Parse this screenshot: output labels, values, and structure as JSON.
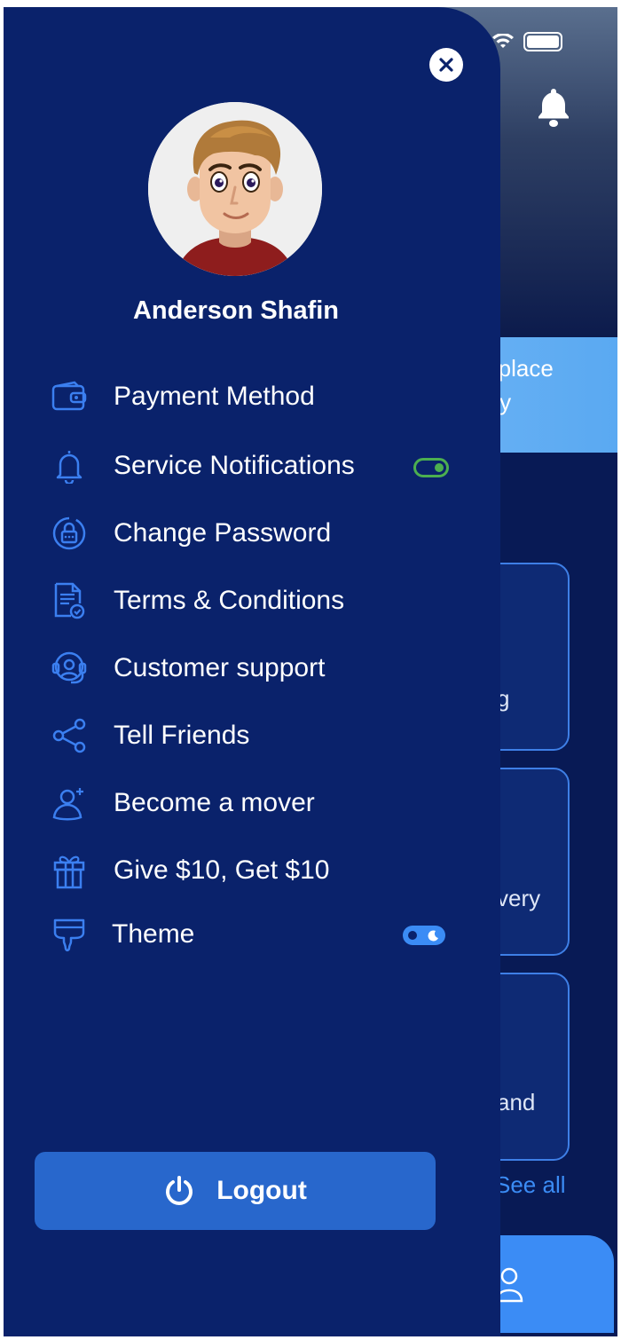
{
  "background_app": {
    "banner_line1": "etplace",
    "banner_line2": "ery",
    "card1_text": "g",
    "card2_text": "very",
    "card3_text": "and",
    "see_all": "See all"
  },
  "drawer": {
    "user_name": "Anderson Shafin",
    "menu": [
      {
        "label": "Payment Method",
        "icon": "wallet-icon"
      },
      {
        "label": "Service Notifications",
        "icon": "bell-icon"
      },
      {
        "label": "Change Password",
        "icon": "lock-icon"
      },
      {
        "label": "Terms & Conditions",
        "icon": "document-check-icon"
      },
      {
        "label": "Customer support",
        "icon": "headset-icon"
      },
      {
        "label": "Tell Friends",
        "icon": "share-icon"
      },
      {
        "label": "Become a mover",
        "icon": "user-plus-icon"
      },
      {
        "label": "Give $10, Get $10",
        "icon": "gift-icon"
      },
      {
        "label": "Theme",
        "icon": "paint-brush-icon"
      }
    ],
    "notifications_enabled": true,
    "dark_theme_enabled": true,
    "logout_label": "Logout"
  },
  "colors": {
    "drawer_bg": "#0a226b",
    "accent_blue": "#3b8cf5",
    "logout_bg": "#2867cc",
    "toggle_green": "#4caf50",
    "icon_blue": "#3b7ff0"
  }
}
